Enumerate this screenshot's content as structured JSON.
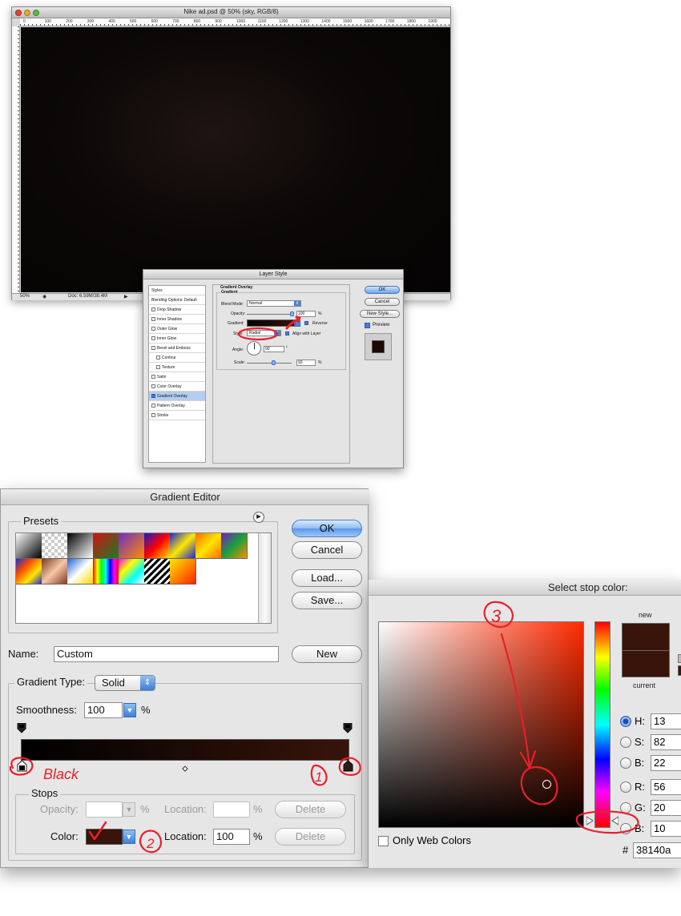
{
  "document_window": {
    "title": "Nike ad.psd @ 50% (sky, RGB/8)",
    "ruler_ticks": [
      "0",
      "100",
      "200",
      "300",
      "400",
      "500",
      "600",
      "700",
      "800",
      "900",
      "1000",
      "1100",
      "1200",
      "1300",
      "1400",
      "1500",
      "1600",
      "1700",
      "1800",
      "1900"
    ],
    "zoom": "50%",
    "doc_info": "Doc: 6.59M/38.4M"
  },
  "layer_style": {
    "title": "Layer Style",
    "styles_header": "Styles",
    "blending_options": "Blending Options: Default",
    "effects": [
      {
        "label": "Drop Shadow",
        "checked": false,
        "selected": false,
        "indent": false
      },
      {
        "label": "Inner Shadow",
        "checked": false,
        "selected": false,
        "indent": false
      },
      {
        "label": "Outer Glow",
        "checked": false,
        "selected": false,
        "indent": false
      },
      {
        "label": "Inner Glow",
        "checked": false,
        "selected": false,
        "indent": false
      },
      {
        "label": "Bevel and Emboss",
        "checked": false,
        "selected": false,
        "indent": false
      },
      {
        "label": "Contour",
        "checked": false,
        "selected": false,
        "indent": true
      },
      {
        "label": "Texture",
        "checked": false,
        "selected": false,
        "indent": true
      },
      {
        "label": "Satin",
        "checked": false,
        "selected": false,
        "indent": false
      },
      {
        "label": "Color Overlay",
        "checked": false,
        "selected": false,
        "indent": false
      },
      {
        "label": "Gradient Overlay",
        "checked": true,
        "selected": true,
        "indent": false
      },
      {
        "label": "Pattern Overlay",
        "checked": false,
        "selected": false,
        "indent": false
      },
      {
        "label": "Stroke",
        "checked": false,
        "selected": false,
        "indent": false
      }
    ],
    "panel": {
      "section_title": "Gradient Overlay",
      "subsection_title": "Gradient",
      "blend_mode_label": "Blend Mode:",
      "blend_mode_value": "Normal",
      "opacity_label": "Opacity:",
      "opacity_value": "100",
      "opacity_unit": "%",
      "gradient_label": "Gradient:",
      "reverse_label": "Reverse",
      "style_label": "Style:",
      "style_value": "Radial",
      "align_label": "Align with Layer",
      "angle_label": "Angle:",
      "angle_value": "90",
      "angle_unit": "°",
      "scale_label": "Scale:",
      "scale_value": "93",
      "scale_unit": "%"
    },
    "buttons": {
      "ok": "OK",
      "cancel": "Cancel",
      "new_style": "New Style..."
    },
    "preview_label": "Preview"
  },
  "gradient_editor": {
    "title": "Gradient Editor",
    "presets_label": "Presets",
    "buttons": {
      "ok": "OK",
      "cancel": "Cancel",
      "load": "Load...",
      "save": "Save...",
      "new": "New"
    },
    "name_label": "Name:",
    "name_value": "Custom",
    "gradient_type_label": "Gradient Type:",
    "gradient_type_value": "Solid",
    "smoothness_label": "Smoothness:",
    "smoothness_value": "100",
    "smoothness_unit": "%",
    "stops_label": "Stops",
    "opacity_label": "Opacity:",
    "opacity_unit": "%",
    "location_label": "Location:",
    "location_unit": "%",
    "delete_label": "Delete",
    "color_label": "Color:",
    "color_location_value": "100",
    "stop_color": "#38140a",
    "gradient_start_color": "#000000",
    "gradient_end_color": "#38140a"
  },
  "color_picker": {
    "title": "Select stop color:",
    "new_label": "new",
    "current_label": "current",
    "new_color": "#38140a",
    "fields": [
      {
        "label": "H:",
        "value": "13",
        "selected": true
      },
      {
        "label": "S:",
        "value": "82",
        "selected": false
      },
      {
        "label": "B:",
        "value": "22",
        "selected": false
      },
      {
        "label": "R:",
        "value": "56",
        "selected": false
      },
      {
        "label": "G:",
        "value": "20",
        "selected": false
      },
      {
        "label": "B:",
        "value": "10",
        "selected": false
      }
    ],
    "only_web_colors_label": "Only Web Colors",
    "hex_label": "#",
    "hex_value": "38140a"
  },
  "annotations": {
    "black_label": "Black",
    "step_1": "1",
    "step_2": "2",
    "step_3": "3",
    "ink_color": "#e8202a"
  }
}
